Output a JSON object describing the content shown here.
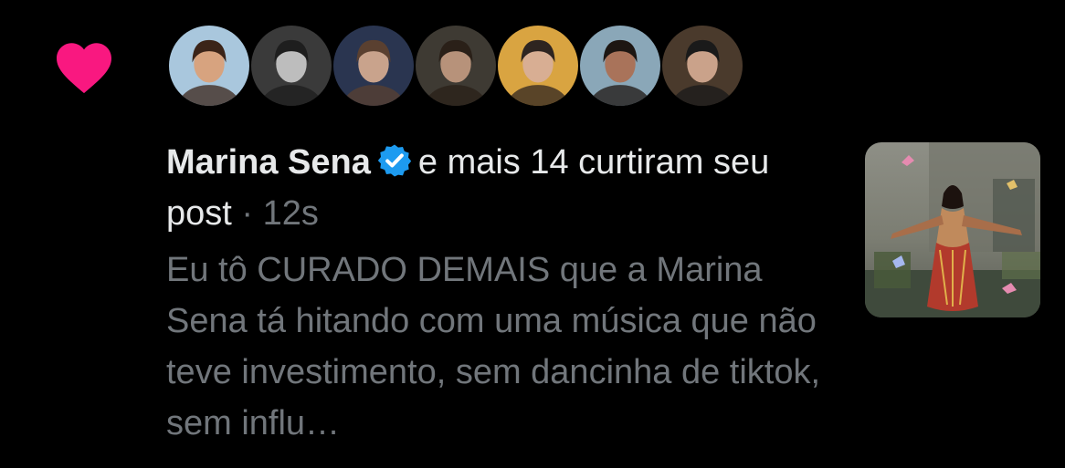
{
  "notification": {
    "type_icon": "heart-icon",
    "type_icon_color": "#f91880",
    "avatars": [
      {
        "name": "avatar-1",
        "bg": "#a9c7dd",
        "skin": "#d7a37f",
        "hair": "#3b2418"
      },
      {
        "name": "avatar-2",
        "bg": "#3a3a3a",
        "skin": "#bdbdbd",
        "hair": "#1e1e1e"
      },
      {
        "name": "avatar-3",
        "bg": "#2a3550",
        "skin": "#c9a38c",
        "hair": "#5a4030"
      },
      {
        "name": "avatar-4",
        "bg": "#3e3a33",
        "skin": "#b7927a",
        "hair": "#2a2018"
      },
      {
        "name": "avatar-5",
        "bg": "#d9a441",
        "skin": "#d8ae93",
        "hair": "#2e2420"
      },
      {
        "name": "avatar-6",
        "bg": "#8aa7b8",
        "skin": "#a9735a",
        "hair": "#1d1612"
      },
      {
        "name": "avatar-7",
        "bg": "#4a3a2c",
        "skin": "#caa28a",
        "hair": "#1a1a1a"
      }
    ],
    "liker_name": "Marina Sena",
    "verified_icon": "verified-badge-icon",
    "verified_color": "#1d9bf0",
    "action_text": "e mais 14 curtiram seu post",
    "separator": "·",
    "timestamp": "12s",
    "post_excerpt": "Eu tô CURADO DEMAIS que a Marina Sena tá hitando com uma música que não teve investimento, sem dancinha de tiktok, sem influ…",
    "thumbnail": "post-media-thumbnail"
  }
}
